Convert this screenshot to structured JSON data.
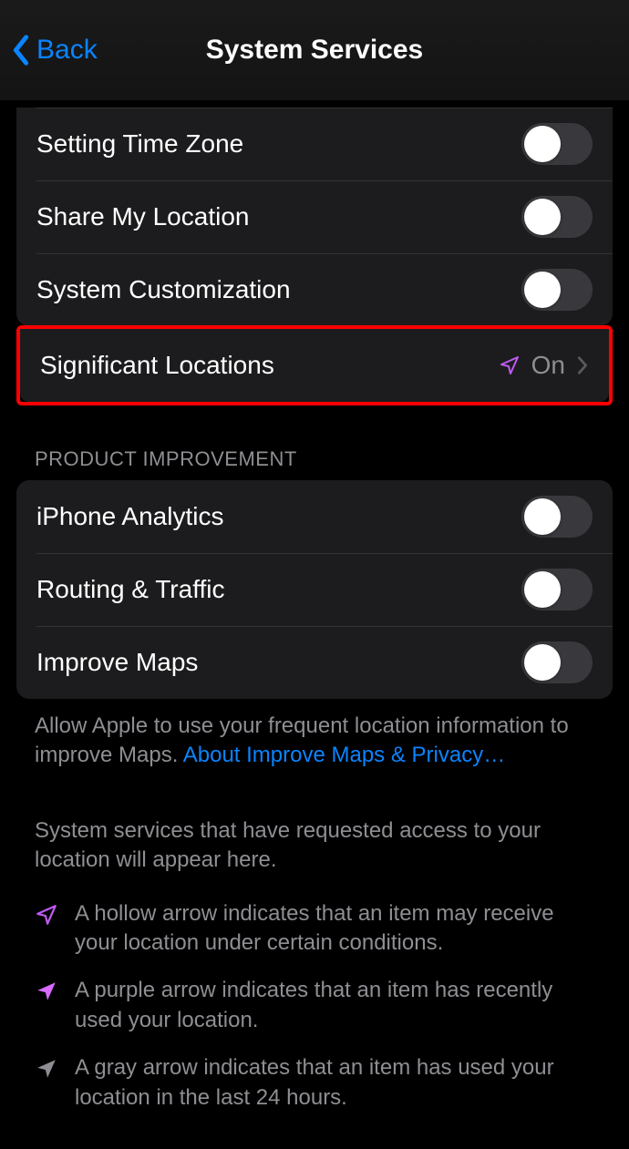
{
  "nav": {
    "back": "Back",
    "title": "System Services"
  },
  "group1": {
    "time_zone": "Setting Time Zone",
    "share_loc": "Share My Location",
    "sys_custom": "System Customization",
    "sig_loc": "Significant Locations",
    "sig_loc_value": "On"
  },
  "section2": {
    "header": "PRODUCT IMPROVEMENT",
    "iphone_analytics": "iPhone Analytics",
    "routing": "Routing & Traffic",
    "improve_maps": "Improve Maps",
    "footer_pre": "Allow Apple to use your frequent location information to improve Maps. ",
    "footer_link": "About Improve Maps & Privacy…"
  },
  "info": "System services that have requested access to your location will appear here.",
  "legend": {
    "hollow": "A hollow arrow indicates that an item may receive your location under certain conditions.",
    "purple": "A purple arrow indicates that an item has recently used your location.",
    "gray": "A gray arrow indicates that an item has used your location in the last 24 hours."
  },
  "colors": {
    "accent_blue": "#0a84ff",
    "purple": "#bf5af2",
    "gray_text": "#8e8e93",
    "row_bg": "#1c1c1e"
  },
  "toggles": {
    "time_zone": false,
    "share_loc": false,
    "sys_custom": false,
    "iphone_analytics": false,
    "routing": false,
    "improve_maps": false
  }
}
